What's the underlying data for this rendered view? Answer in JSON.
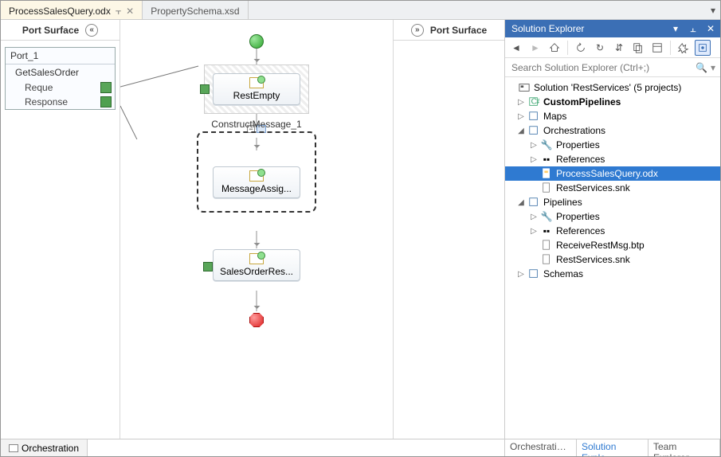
{
  "tabs": {
    "items": [
      {
        "label": "ProcessSalesQuery.odx",
        "active": true,
        "closable": true
      },
      {
        "label": "PropertySchema.xsd",
        "active": false,
        "closable": false
      }
    ]
  },
  "designer": {
    "left_port_title": "Port Surface",
    "right_port_title": "Port Surface",
    "port": {
      "name": "Port_1",
      "operation": "GetSalesOrder",
      "request_label": "Reque",
      "response_label": "Response"
    },
    "shapes": {
      "receive": "RestEmpty",
      "construct": "ConstructMessage_1",
      "assign": "MessageAssig...",
      "send": "SalesOrderRes..."
    },
    "bottom_tab": "Orchestration"
  },
  "solution_explorer": {
    "title": "Solution Explorer",
    "search_placeholder": "Search Solution Explorer (Ctrl+;)",
    "root": "Solution 'RestServices' (5 projects)",
    "nodes": {
      "custom_pipelines": "CustomPipelines",
      "maps": "Maps",
      "orchestrations": "Orchestrations",
      "orch_props": "Properties",
      "orch_refs": "References",
      "orch_file": "ProcessSalesQuery.odx",
      "orch_snk": "RestServices.snk",
      "pipelines": "Pipelines",
      "pipe_props": "Properties",
      "pipe_refs": "References",
      "pipe_btp": "ReceiveRestMsg.btp",
      "pipe_snk": "RestServices.snk",
      "schemas": "Schemas"
    },
    "bottom_tabs": {
      "orch": "Orchestration...",
      "sln": "Solution Explo...",
      "team": "Team Explorer"
    }
  }
}
